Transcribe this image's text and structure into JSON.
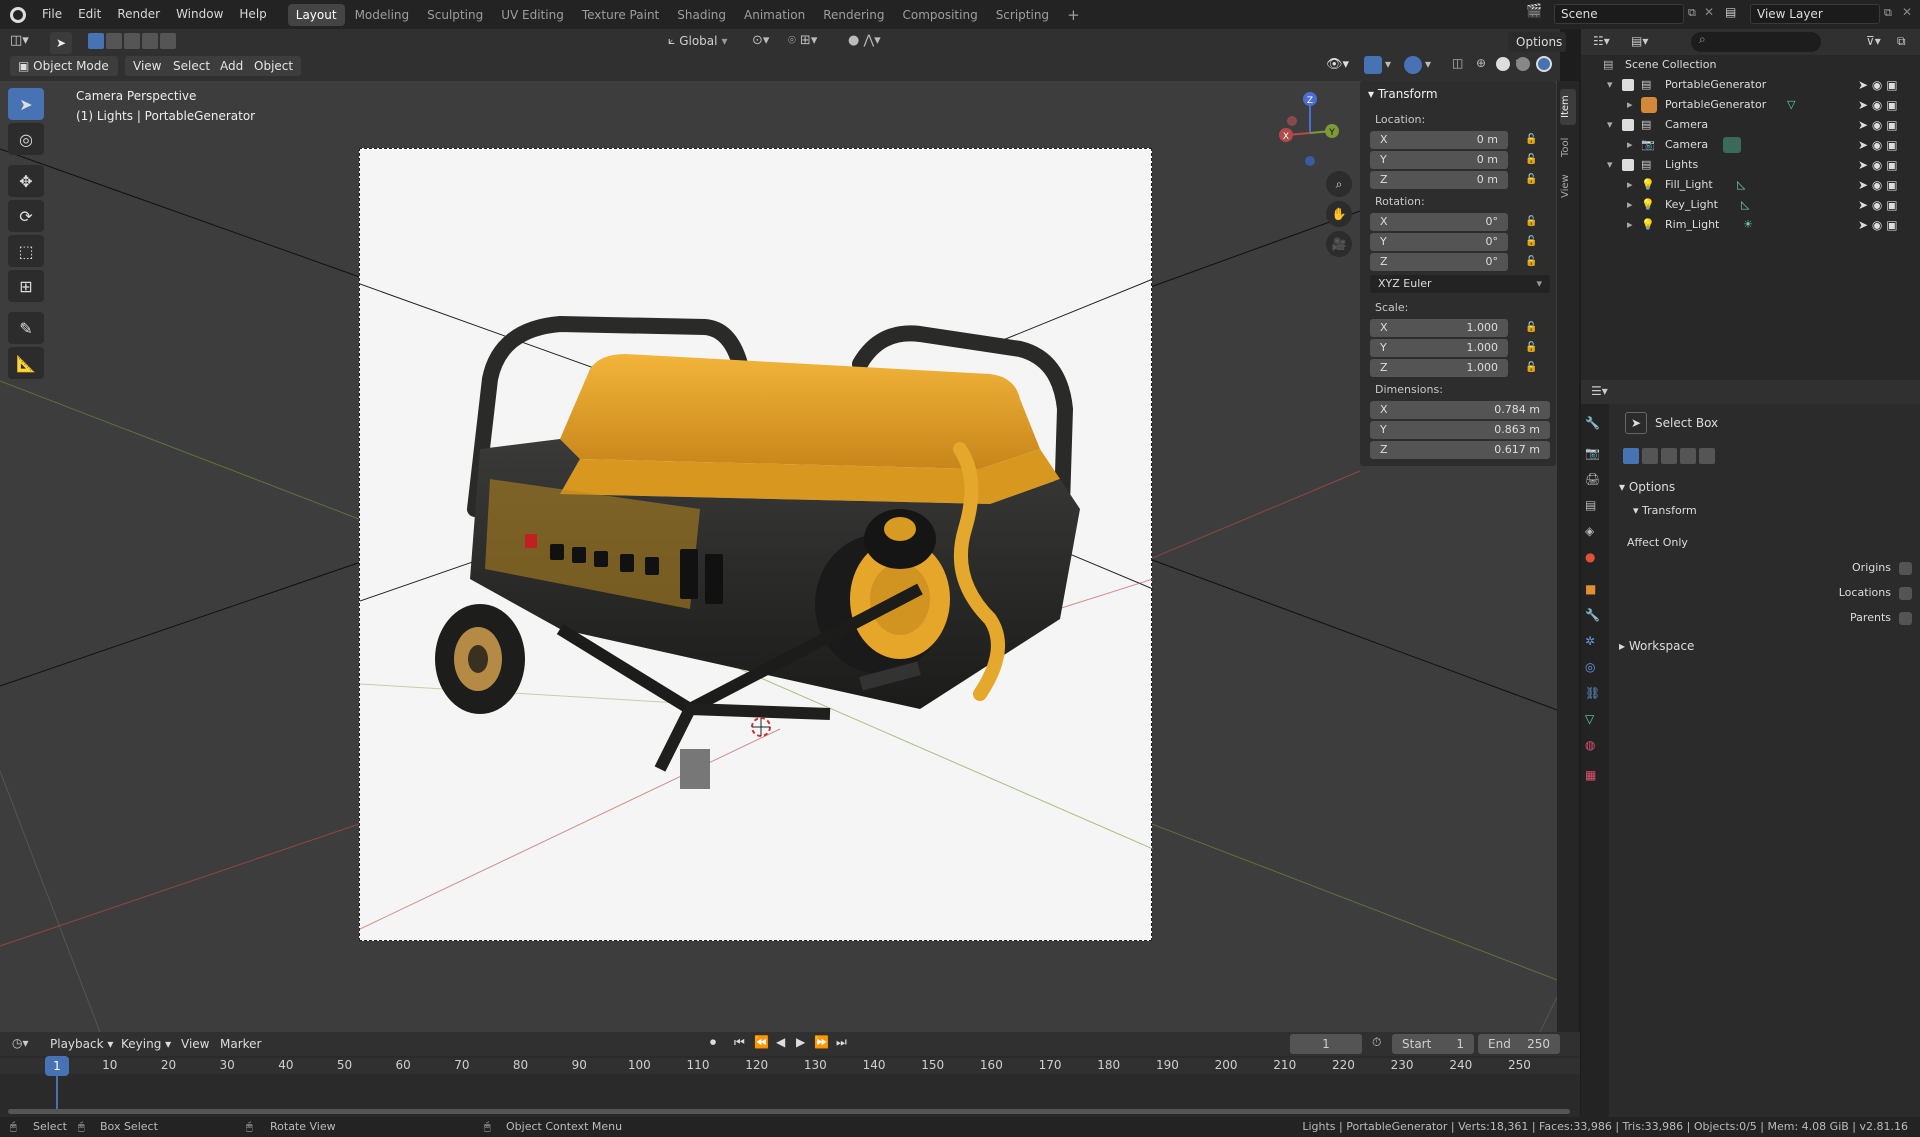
{
  "topbar": {
    "menus": [
      "File",
      "Edit",
      "Render",
      "Window",
      "Help"
    ],
    "workspaces": [
      "Layout",
      "Modeling",
      "Sculpting",
      "UV Editing",
      "Texture Paint",
      "Shading",
      "Animation",
      "Rendering",
      "Compositing",
      "Scripting"
    ],
    "active_workspace": "Layout",
    "add_tab": "+",
    "scene": "Scene",
    "view_layer": "View Layer"
  },
  "viewport_header": {
    "transform_orientation": "Global",
    "options": "Options",
    "mode": "Object Mode",
    "menus": [
      "View",
      "Select",
      "Add",
      "Object"
    ]
  },
  "viewport": {
    "camera_label": "Camera Perspective",
    "object_label": "(1) Lights | PortableGenerator",
    "axes": {
      "x": "X",
      "y": "Y",
      "z": "Z"
    }
  },
  "npanel": {
    "tabs": [
      "Item",
      "Tool",
      "View"
    ],
    "header": "Transform",
    "location_label": "Location:",
    "location": [
      {
        "axis": "X",
        "value": "0 m"
      },
      {
        "axis": "Y",
        "value": "0 m"
      },
      {
        "axis": "Z",
        "value": "0 m"
      }
    ],
    "rotation_label": "Rotation:",
    "rotation": [
      {
        "axis": "X",
        "value": "0°"
      },
      {
        "axis": "Y",
        "value": "0°"
      },
      {
        "axis": "Z",
        "value": "0°"
      }
    ],
    "rotation_mode": "XYZ Euler",
    "scale_label": "Scale:",
    "scale": [
      {
        "axis": "X",
        "value": "1.000"
      },
      {
        "axis": "Y",
        "value": "1.000"
      },
      {
        "axis": "Z",
        "value": "1.000"
      }
    ],
    "dimensions_label": "Dimensions:",
    "dimensions": [
      {
        "axis": "X",
        "value": "0.784 m"
      },
      {
        "axis": "Y",
        "value": "0.863 m"
      },
      {
        "axis": "Z",
        "value": "0.617 m"
      }
    ]
  },
  "outliner": {
    "root": "Scene Collection",
    "rows": [
      {
        "label": "PortableGenerator",
        "kind": "collection"
      },
      {
        "label": "PortableGenerator",
        "kind": "mesh"
      },
      {
        "label": "Camera",
        "kind": "collection"
      },
      {
        "label": "Camera",
        "kind": "camera"
      },
      {
        "label": "Lights",
        "kind": "collection"
      },
      {
        "label": "Fill_Light",
        "kind": "light"
      },
      {
        "label": "Key_Light",
        "kind": "light"
      },
      {
        "label": "Rim_Light",
        "kind": "light"
      }
    ]
  },
  "properties": {
    "tool_name": "Select Box",
    "options": "Options",
    "transform": "Transform",
    "affect_only": "Affect Only",
    "origins": "Origins",
    "locations": "Locations",
    "parents": "Parents",
    "workspace": "Workspace"
  },
  "timeline": {
    "menus": [
      "Playback",
      "Keying",
      "View",
      "Marker"
    ],
    "current_frame": "1",
    "start_label": "Start",
    "start": "1",
    "end_label": "End",
    "end": "250",
    "ticks": [
      "1",
      "10",
      "20",
      "30",
      "40",
      "50",
      "60",
      "70",
      "80",
      "90",
      "100",
      "110",
      "120",
      "130",
      "140",
      "150",
      "160",
      "170",
      "180",
      "190",
      "200",
      "210",
      "220",
      "230",
      "240",
      "250"
    ]
  },
  "statusbar": {
    "select": "Select",
    "box_select": "Box Select",
    "rotate_view": "Rotate View",
    "context_menu": "Object Context Menu",
    "stats": "Lights | PortableGenerator | Verts:18,361 | Faces:33,986 | Tris:33,986 | Objects:0/5 | Mem: 4.08 GiB | v2.81.16"
  },
  "colors": {
    "accent": "#4772b3",
    "x_axis": "#b44b4b",
    "y_axis": "#7c9a36",
    "z_axis": "#4a6fd0",
    "generator_yellow": "#e8a52a"
  }
}
